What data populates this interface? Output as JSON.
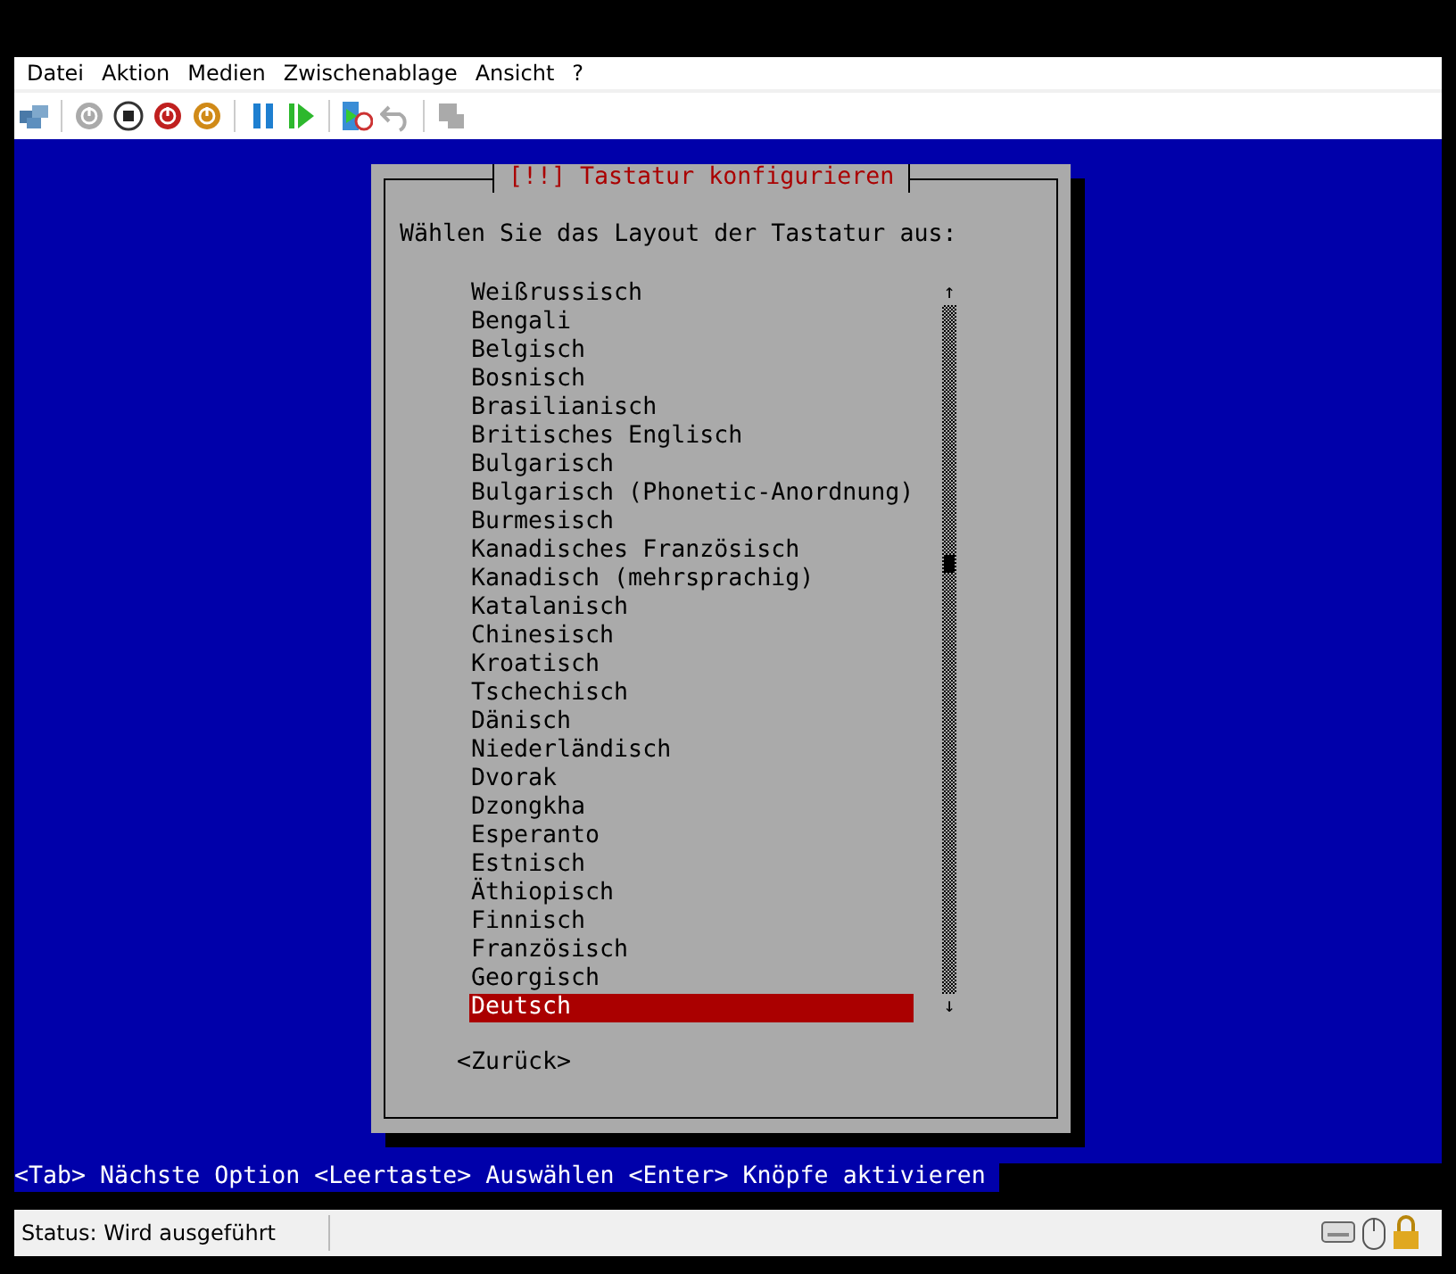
{
  "menu": [
    "Datei",
    "Aktion",
    "Medien",
    "Zwischenablage",
    "Ansicht",
    "?"
  ],
  "toolbar": [
    {
      "kind": "network",
      "disabled": false
    },
    {
      "kind": "sep"
    },
    {
      "kind": "power",
      "disabled": true
    },
    {
      "kind": "stop",
      "disabled": false
    },
    {
      "kind": "shutdown",
      "disabled": false
    },
    {
      "kind": "sleep",
      "disabled": false
    },
    {
      "kind": "sep"
    },
    {
      "kind": "pause",
      "disabled": false
    },
    {
      "kind": "play",
      "disabled": false
    },
    {
      "kind": "sep"
    },
    {
      "kind": "checkpoint",
      "disabled": false
    },
    {
      "kind": "revert",
      "disabled": true
    },
    {
      "kind": "sep"
    },
    {
      "kind": "share",
      "disabled": true
    }
  ],
  "dialog": {
    "title": "[!!] Tastatur konfigurieren",
    "prompt": "Wählen Sie das Layout der Tastatur aus:",
    "scroll_up": "↑",
    "scroll_down": "↓",
    "items": [
      {
        "label": "Weißrussisch",
        "selected": false
      },
      {
        "label": "Bengali",
        "selected": false
      },
      {
        "label": "Belgisch",
        "selected": false
      },
      {
        "label": "Bosnisch",
        "selected": false
      },
      {
        "label": "Brasilianisch",
        "selected": false
      },
      {
        "label": "Britisches Englisch",
        "selected": false
      },
      {
        "label": "Bulgarisch",
        "selected": false
      },
      {
        "label": "Bulgarisch (Phonetic-Anordnung)",
        "selected": false
      },
      {
        "label": "Burmesisch",
        "selected": false
      },
      {
        "label": "Kanadisches Französisch",
        "selected": false
      },
      {
        "label": "Kanadisch (mehrsprachig)",
        "selected": false
      },
      {
        "label": "Katalanisch",
        "selected": false
      },
      {
        "label": "Chinesisch",
        "selected": false
      },
      {
        "label": "Kroatisch",
        "selected": false
      },
      {
        "label": "Tschechisch",
        "selected": false
      },
      {
        "label": "Dänisch",
        "selected": false
      },
      {
        "label": "Niederländisch",
        "selected": false
      },
      {
        "label": "Dvorak",
        "selected": false
      },
      {
        "label": "Dzongkha",
        "selected": false
      },
      {
        "label": "Esperanto",
        "selected": false
      },
      {
        "label": "Estnisch",
        "selected": false
      },
      {
        "label": "Äthiopisch",
        "selected": false
      },
      {
        "label": "Finnisch",
        "selected": false
      },
      {
        "label": "Französisch",
        "selected": false
      },
      {
        "label": "Georgisch",
        "selected": false
      },
      {
        "label": "Deutsch",
        "selected": true
      }
    ],
    "back_button": "<Zurück>"
  },
  "hint": "<Tab> Nächste Option <Leertaste> Auswählen <Enter> Knöpfe aktivieren",
  "status_bar": {
    "text": "Status: Wird ausgeführt"
  }
}
